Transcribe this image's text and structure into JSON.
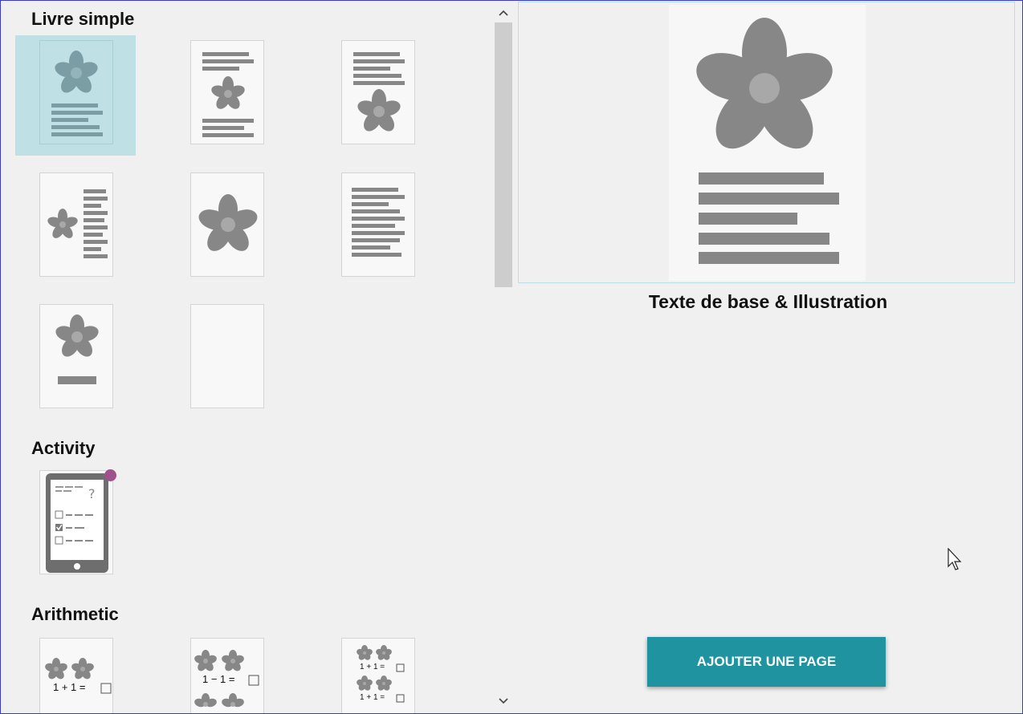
{
  "sections": {
    "basic": {
      "title": "Livre simple"
    },
    "activity": {
      "title": "Activity"
    },
    "arithmetic": {
      "title": "Arithmetic"
    }
  },
  "arith": {
    "t1": "1 + 1 =",
    "t2": "1 − 1 =",
    "t3a": "1 + 1 =",
    "t3b": "1 + 1 ="
  },
  "preview": {
    "title": "Texte de base & Illustration"
  },
  "actions": {
    "add_page": "AJOUTER UNE PAGE"
  },
  "colors": {
    "accent": "#1f93a0",
    "selected": "#bfe0e4",
    "placeholder": "#878787",
    "badge": "#a0508a"
  }
}
